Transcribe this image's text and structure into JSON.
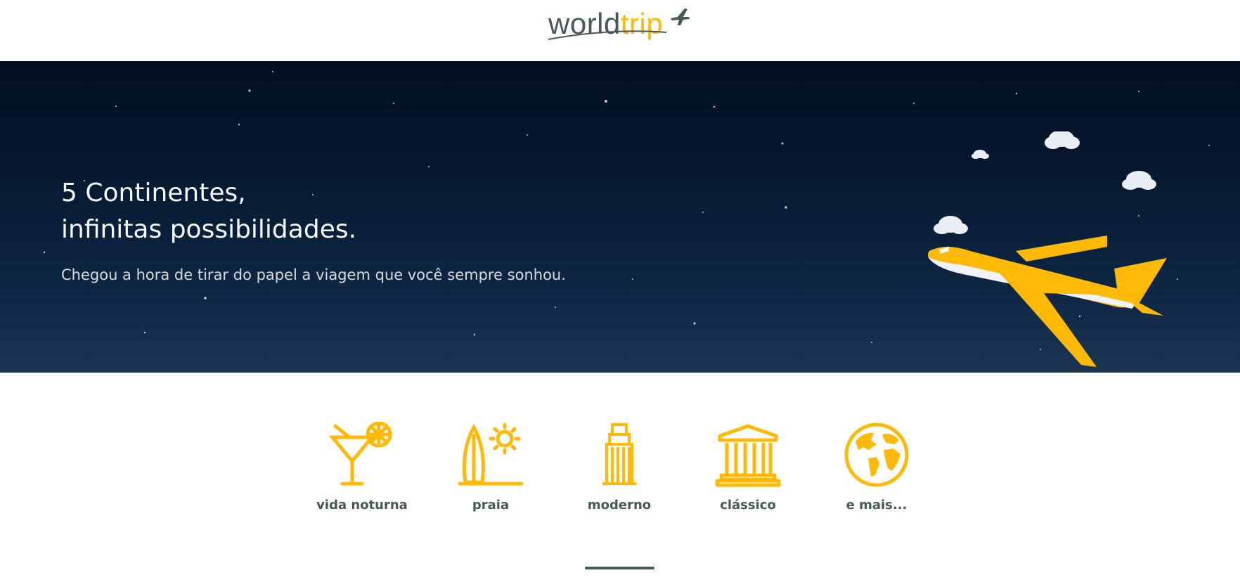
{
  "header": {
    "logo": {
      "part1": "world",
      "part2": "trip"
    }
  },
  "banner": {
    "title_line1": "5 Continentes,",
    "title_line2": "infinitas possibilidades.",
    "subtitle": "Chegou a hora de tirar do papel a viagem que você sempre sonhou."
  },
  "travel_types": [
    {
      "label": "vida noturna",
      "icon": "cocktail-icon"
    },
    {
      "label": "praia",
      "icon": "surf-sun-icon"
    },
    {
      "label": "moderno",
      "icon": "skyscraper-icon"
    },
    {
      "label": "clássico",
      "icon": "museum-icon"
    },
    {
      "label": "e mais...",
      "icon": "globe-icon"
    }
  ],
  "colors": {
    "highlight": "#FFBA08",
    "dark_text": "#47585B",
    "light_text": "#F5F8FA",
    "banner_bg": "#071a33"
  }
}
